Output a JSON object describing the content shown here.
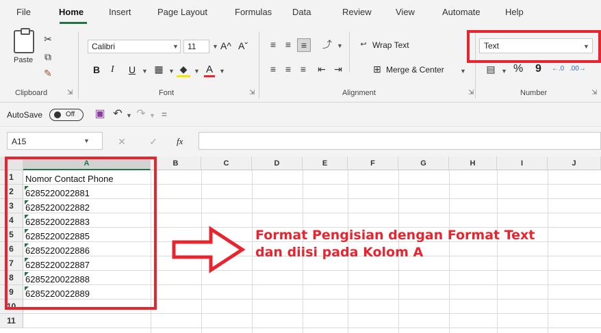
{
  "menu": {
    "tabs": [
      "File",
      "Home",
      "Insert",
      "Page Layout",
      "Formulas",
      "Data",
      "Review",
      "View",
      "Automate",
      "Help"
    ],
    "active": "Home"
  },
  "ribbon": {
    "clipboard": {
      "paste": "Paste",
      "label": "Clipboard"
    },
    "font": {
      "name": "Calibri",
      "size": "11",
      "label": "Font",
      "bold": "B",
      "italic": "I",
      "underline": "U",
      "grow": "A^",
      "shrink": "Aˇ",
      "font_color": "A"
    },
    "alignment": {
      "wrap": "Wrap Text",
      "merge": "Merge & Center",
      "label": "Alignment"
    },
    "number": {
      "format": "Text",
      "label": "Number",
      "percent": "%",
      "comma": "9"
    }
  },
  "qat": {
    "autosave": "AutoSave",
    "toggle": "Off"
  },
  "formula_bar": {
    "name_box": "A15",
    "fx": "fx"
  },
  "grid": {
    "columns": [
      "A",
      "B",
      "C",
      "D",
      "E",
      "F",
      "G",
      "H",
      "I",
      "J"
    ],
    "rows": [
      "1",
      "2",
      "3",
      "4",
      "5",
      "6",
      "7",
      "8",
      "9",
      "10",
      "11"
    ],
    "cells_a": [
      "Nomor Contact Phone",
      "6285220022881",
      "6285220022882",
      "6285220022883",
      "6285220022885",
      "6285220022886",
      "6285220022887",
      "6285220022888",
      "6285220022889"
    ]
  },
  "annotation": {
    "line1": "Format Pengisian dengan Format Text",
    "line2": "dan diisi pada Kolom A"
  },
  "colors": {
    "accent": "#217346",
    "highlight": "#e8252f"
  }
}
